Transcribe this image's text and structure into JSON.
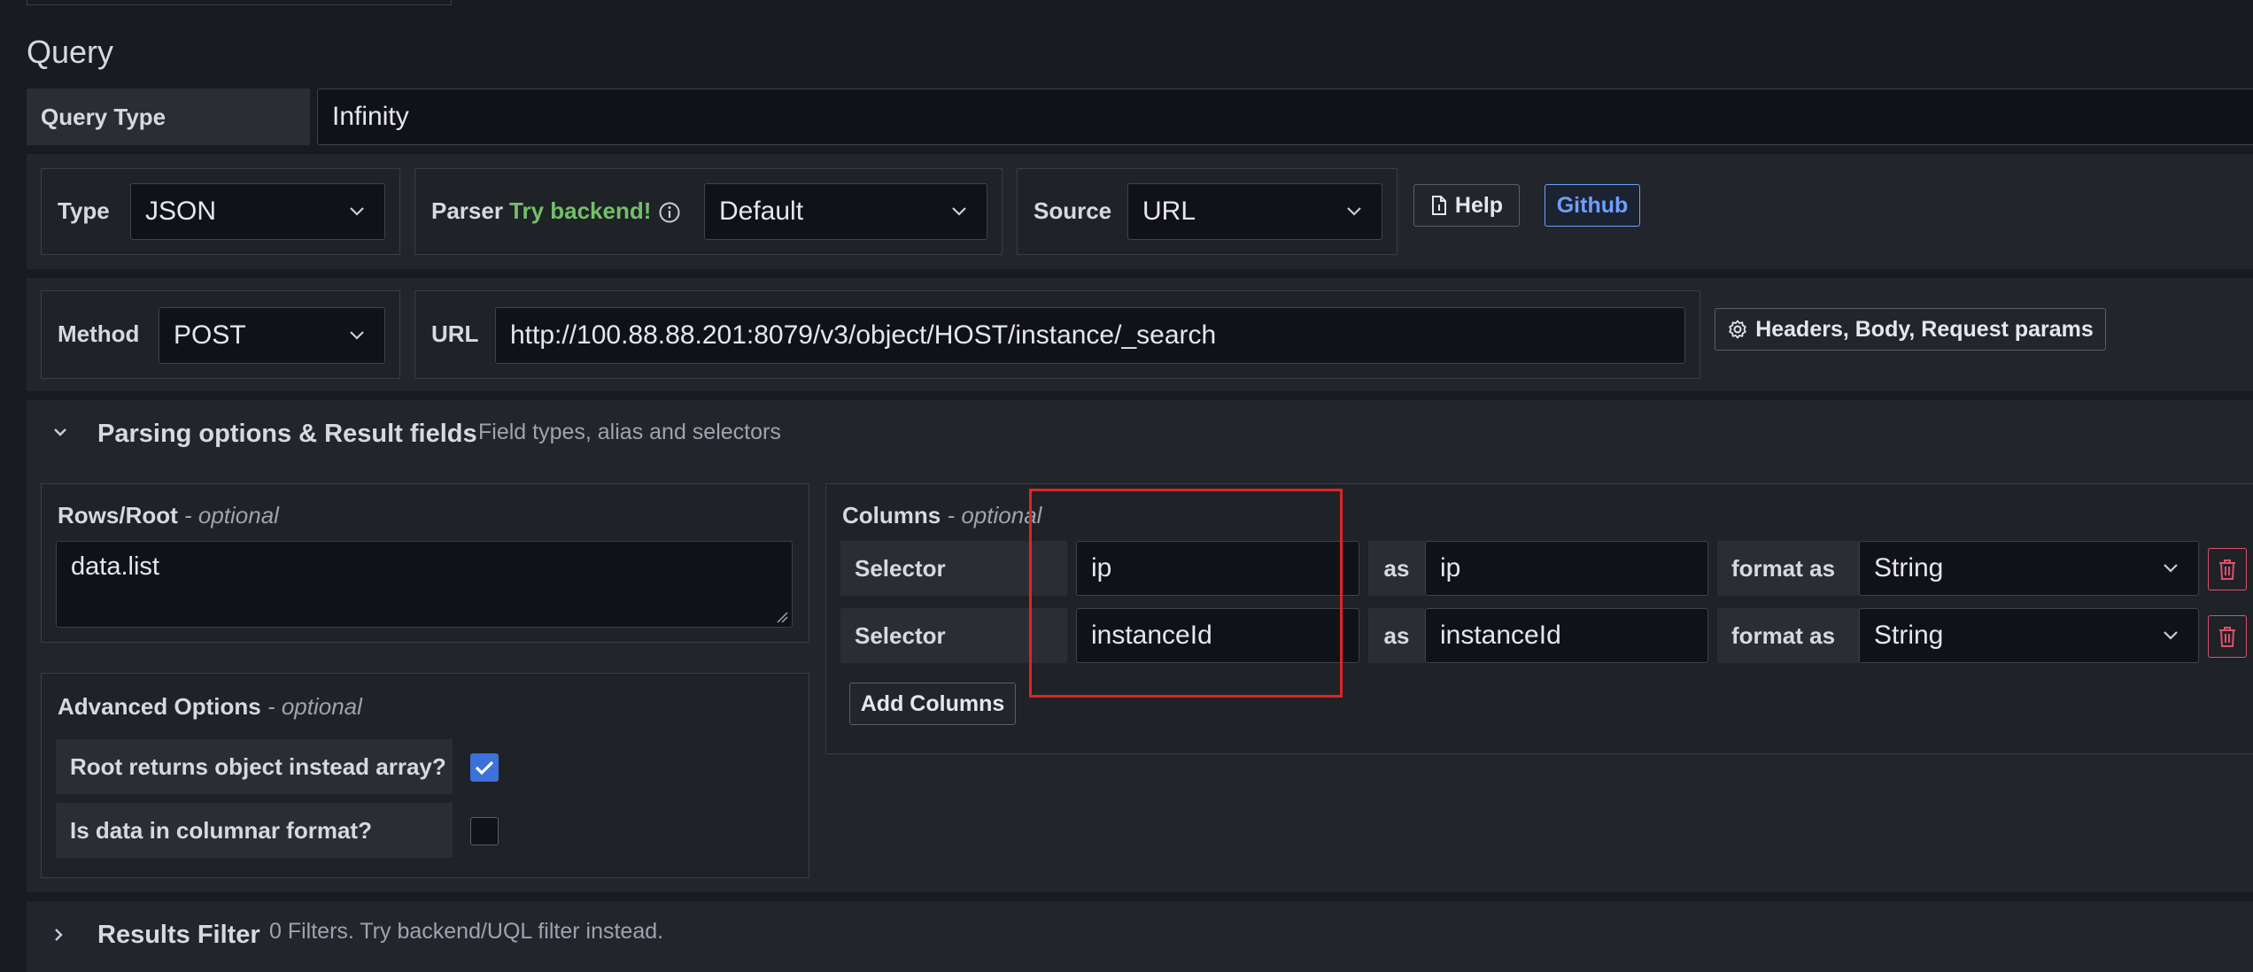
{
  "section_title": "Query",
  "query_type": {
    "label": "Query Type",
    "value": "Infinity"
  },
  "row1": {
    "type_label": "Type",
    "type_value": "JSON",
    "parser_label": "Parser",
    "parser_hint": "Try backend!",
    "parser_value": "Default",
    "source_label": "Source",
    "source_value": "URL",
    "help_label": "Help",
    "github_label": "Github"
  },
  "row2": {
    "method_label": "Method",
    "method_value": "POST",
    "url_label": "URL",
    "url_value": "http://100.88.88.201:8079/v3/object/HOST/instance/_search",
    "headers_button": "Headers, Body, Request params"
  },
  "parsing": {
    "title": "Parsing options & Result fields",
    "subtitle": "Field types, alias and selectors",
    "rows_root_label": "Rows/Root",
    "rows_root_optional": "- optional",
    "rows_root_value": "data.list",
    "advanced_label": "Advanced Options",
    "advanced_optional": "- optional",
    "options": [
      {
        "label": "Root returns object instead array?",
        "checked": true
      },
      {
        "label": "Is data in columnar format?",
        "checked": false
      }
    ],
    "columns_label": "Columns",
    "columns_optional": "- optional",
    "columns": [
      {
        "selector_label": "Selector",
        "selector": "ip",
        "as_label": "as",
        "alias": "ip",
        "format_label": "format as",
        "format": "String"
      },
      {
        "selector_label": "Selector",
        "selector": "instanceId",
        "as_label": "as",
        "alias": "instanceId",
        "format_label": "format as",
        "format": "String"
      }
    ],
    "add_columns": "Add Columns"
  },
  "results_filter": {
    "title": "Results Filter",
    "subtitle": "0 Filters. Try backend/UQL filter instead."
  },
  "colors": {
    "accent_green": "#73bf69",
    "accent_blue": "#6e9fff",
    "highlight_red": "#e02424",
    "checkbox_blue": "#3d71d9"
  }
}
